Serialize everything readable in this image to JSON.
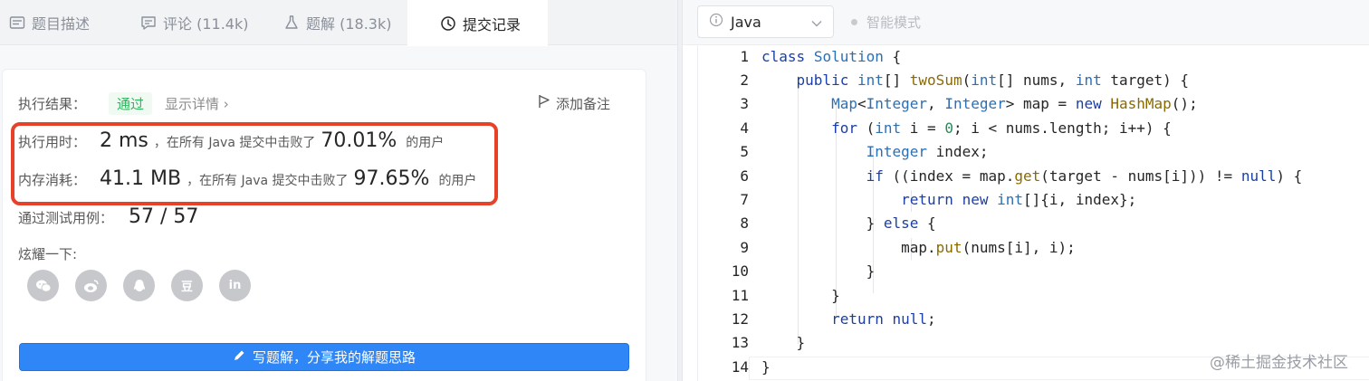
{
  "tabs": [
    {
      "label": "题目描述",
      "icon": "description-icon"
    },
    {
      "label": "评论 (11.4k)",
      "icon": "comment-icon"
    },
    {
      "label": "题解 (18.3k)",
      "icon": "flask-icon"
    },
    {
      "label": "提交记录",
      "icon": "clock-icon"
    }
  ],
  "result": {
    "label": "执行结果：",
    "status": "通过",
    "detail_link": "显示详情 ›",
    "note_button": "添加备注"
  },
  "runtime": {
    "label": "执行用时：",
    "value": "2 ms",
    "mid_text": "，在所有 Java 提交中击败了",
    "percent": "70.01%",
    "tail": "的用户"
  },
  "memory": {
    "label": "内存消耗：",
    "value": "41.1 MB",
    "mid_text": "，在所有 Java 提交中击败了",
    "percent": "97.65%",
    "tail": "的用户"
  },
  "tests": {
    "label": "通过测试用例：",
    "value": "57 / 57"
  },
  "share": {
    "label": "炫耀一下:",
    "icons": [
      "wechat-icon",
      "weibo-icon",
      "qq-icon",
      "douban-icon",
      "linkedin-icon"
    ],
    "douban_text": "豆",
    "linkedin_text": "in"
  },
  "write_button": "写题解，分享我的解题思路",
  "editor": {
    "language": "Java",
    "smart_mode": "智能模式",
    "line_numbers": [
      "1",
      "2",
      "3",
      "4",
      "5",
      "6",
      "7",
      "8",
      "9",
      "10",
      "11",
      "12",
      "13",
      "14"
    ]
  },
  "watermark": "@稀土掘金技术社区",
  "colors": {
    "accent_blue": "#2f86f6",
    "pass_green": "#2db55d",
    "highlight_red": "#e8412a"
  }
}
